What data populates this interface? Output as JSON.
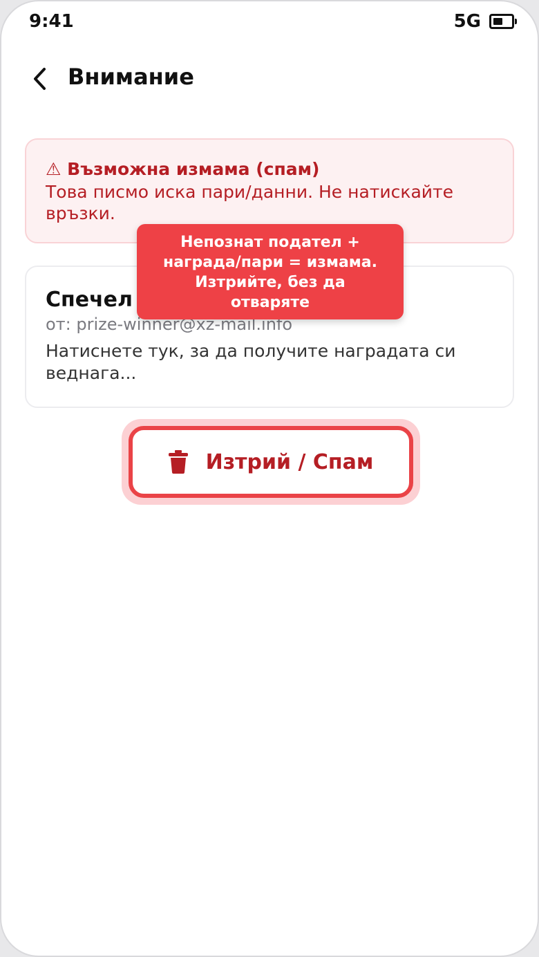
{
  "status_bar": {
    "time": "9:41",
    "network": "5G"
  },
  "header": {
    "title": "Внимание"
  },
  "alert": {
    "icon": "⚠",
    "title": "Възможна измама (спам)",
    "text": "Това писмо иска пари/данни. Не натискайте връзки.",
    "accent_color": "#b51e24"
  },
  "email": {
    "subject": "Спечел",
    "sender": "от: prize-winner@xz-mail.info",
    "preview": "Натиснете тук, за да получите наградата си веднага..."
  },
  "tooltip": {
    "text": "Непознат подател + награда/пари = измама. Изтрийте, без да отваряте",
    "color": "#ee4146"
  },
  "action": {
    "delete_label": "Изтрий / Спам",
    "icon": "trash-icon"
  }
}
